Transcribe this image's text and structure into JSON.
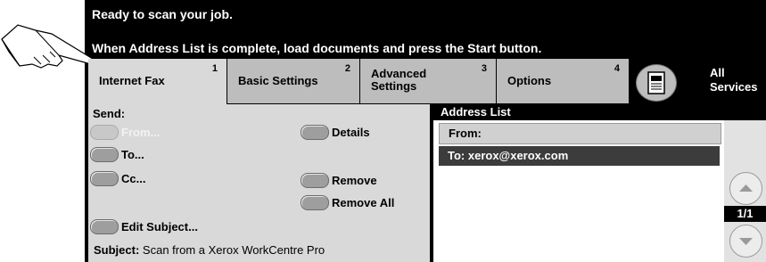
{
  "header": {
    "status_line": "Ready to scan your job.",
    "instruction_line": "When Address List is complete, load documents and press the Start button."
  },
  "tabs": [
    {
      "label": "Internet Fax",
      "number": "1"
    },
    {
      "label": "Basic Settings",
      "number": "2"
    },
    {
      "label_line1": "Advanced",
      "label_line2": "Settings",
      "number": "3"
    },
    {
      "label": "Options",
      "number": "4"
    }
  ],
  "all_services": {
    "line1": "All",
    "line2": "Services",
    "icon": "all-services-icon"
  },
  "send": {
    "title": "Send:",
    "from_label": "From...",
    "to_label": "To...",
    "cc_label": "Cc...",
    "details_label": "Details",
    "remove_label": "Remove",
    "remove_all_label": "Remove All",
    "edit_subject_label": "Edit Subject...",
    "subject_label": "Subject:",
    "subject_value": "Scan from a Xerox WorkCentre Pro"
  },
  "address_list": {
    "title": "Address List",
    "rows": [
      "From:",
      "To: xerox@xerox.com"
    ],
    "page": "1/1"
  },
  "colors": {
    "screen_bg": "#000000",
    "panel_bg": "#d9d9d9",
    "selected_row": "#3c3c3c"
  }
}
